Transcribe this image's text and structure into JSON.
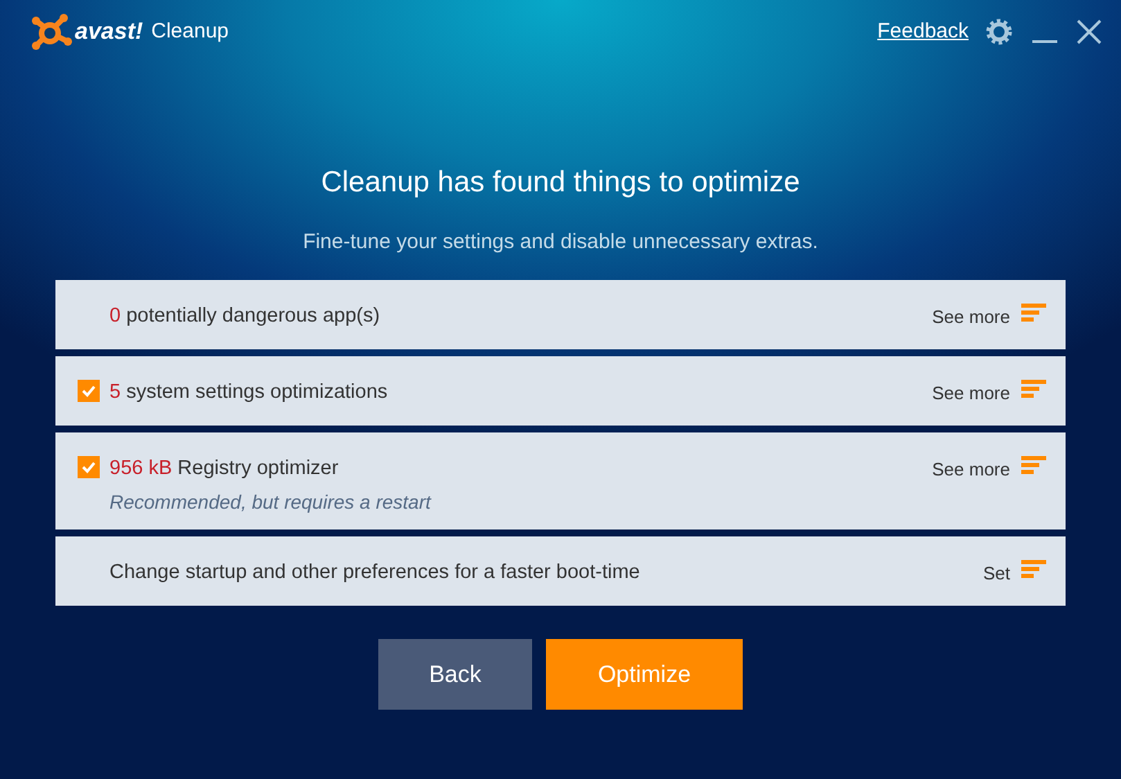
{
  "app": {
    "brand": "avast!",
    "title": "Cleanup",
    "feedback": "Feedback"
  },
  "heading": "Cleanup has found things to optimize",
  "subheading": "Fine-tune your settings and disable unnecessary extras.",
  "rows": [
    {
      "kind": "info",
      "count": "0",
      "label": "potentially dangerous app(s)",
      "action": "See more"
    },
    {
      "kind": "check",
      "checked": true,
      "count": "5",
      "label": "system settings optimizations",
      "action": "See more"
    },
    {
      "kind": "check",
      "checked": true,
      "count": "956 kB",
      "label": "Registry optimizer",
      "note": "Recommended, but requires a restart",
      "action": "See more"
    },
    {
      "kind": "plain",
      "label": "Change startup and other preferences for a faster boot-time",
      "action": "Set"
    }
  ],
  "buttons": [
    {
      "label": "Back",
      "kind": "secondary"
    },
    {
      "label": "Optimize",
      "kind": "primary"
    }
  ]
}
